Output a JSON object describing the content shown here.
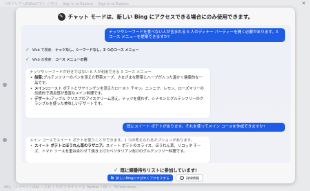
{
  "background": {
    "top_text": [
      "ペタゾリアへのWebアフト パネル",
      "Sign In to Explore",
      "Sign In to Explore"
    ],
    "bottom_text": "MR、マリーノ / DAI ・エビ / カキフライソース Twitter / ID ☆ 7B(Windows,..."
  },
  "modal": {
    "title": "チャット モードは、新しい Bing にアクセスできる場合にのみ使用できます。",
    "user_message_1": "ナッツやシーフードを食べない人が含まれる 6 人のディナー パーティーを開く必要があります。3 コース メニューを提案できますか?",
    "search_1": {
      "prefix": "Web で検索:",
      "query": "ナッツなし、シーフードなし、3 つのコース メニュー"
    },
    "search_2": {
      "prefix": "Web の検索:",
      "query": "コース メニューの例"
    },
    "bot_message_1": {
      "intro": "ナッツやシーフードが好きではない 6 人が利用できる 3 コース メニュー:",
      "items": [
        {
          "label": "前菜:",
          "text": "グルテンフリーのパンを添えた野菜スープ。さまざまな野菜とハーブが入った温かく健康的な一品です。"
        },
        {
          "label": "メイン:",
          "text": "ロースト ポテトとサヤインゲンを添えたロースト チキン。ニンニク、レモン、ローズマリーの伝統的で満足感が豊富なメイン料理です。"
        },
        {
          "label": "デザート:",
          "text": "アップル クリスプのアイスクリーム添え。ナッツを使わず、シナモンとグルテンフリーのクランブルを使った美味しいデザートです。"
        }
      ]
    },
    "user_message_2": "既にスイート ポテトがあります。それを使ってメイン コースを作成できますか?",
    "bot_message_2": {
      "intro": "メイン コースでスイート ポテトを使うことができます。1 つの考えられるオプションがあります。",
      "items": [
        {
          "label": "スイート ポテトとほうれん草のラザニア。",
          "text": "スイート ポテトのスライス、ほうれん草、リコッタ チーズ、トマト ソースを重ね合わせて焼き上げたベジタリアン向けのグルテンフリー料理です。"
        }
      ]
    },
    "joined_text": "既に順番待ちリストに参加しています!",
    "primary_button": "新しいBingにすばやくアクセスする",
    "secondary_button": "詳細情報"
  }
}
